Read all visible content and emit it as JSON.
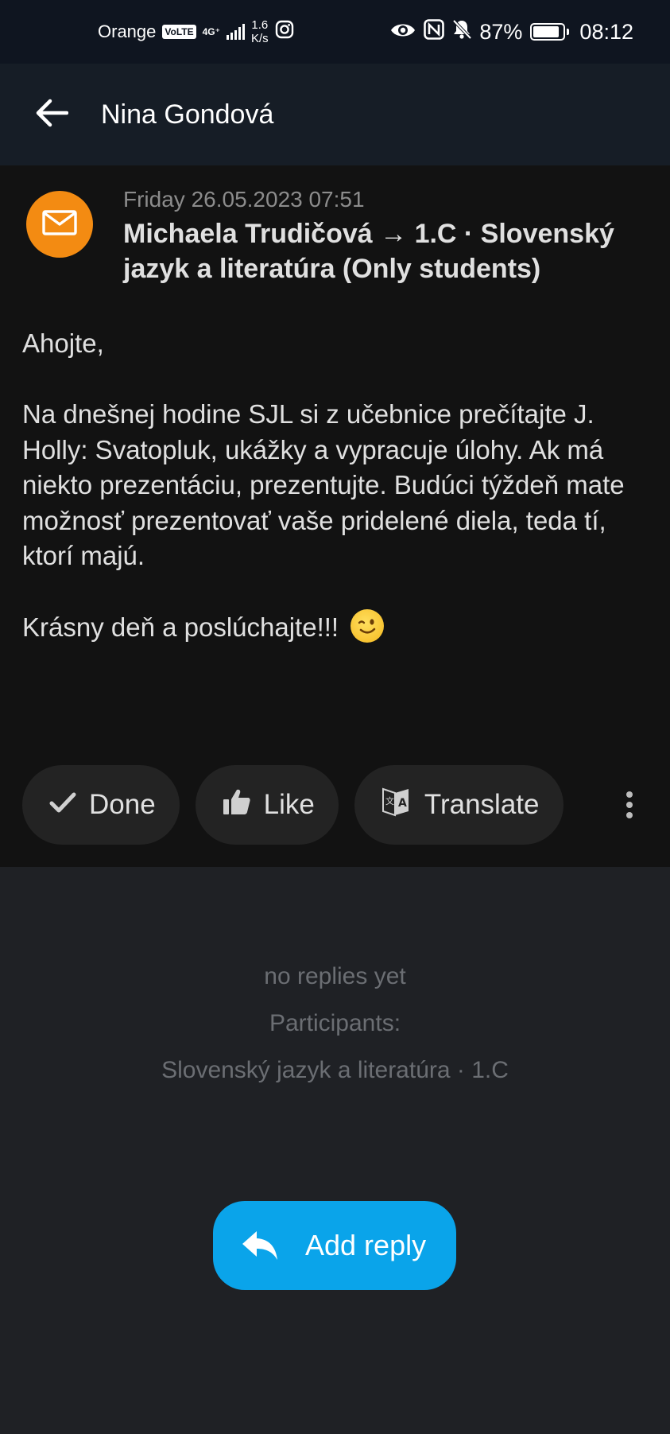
{
  "status_bar": {
    "carrier": "Orange",
    "volte": "VoLTE",
    "network": "4G⁺",
    "speed_value": "1.6",
    "speed_unit": "K/s",
    "battery_percent": "87%",
    "battery_level": 0.87,
    "time": "08:12"
  },
  "app_bar": {
    "title": "Nina Gondová",
    "back_icon": "arrow-left-icon"
  },
  "message": {
    "avatar_icon": "envelope-icon",
    "avatar_color": "#f38b12",
    "date": "Friday 26.05.2023 07:51",
    "sender_line": "Michaela Trudičová → 1.C · Slovenský jazyk a literatúra (Only students)",
    "body": "Ahojte,\n\nNa dnešnej hodine SJL si z učebnice prečítajte J. Holly: Svatopluk, ukážky a vypracuje úlohy. Ak má niekto prezentáciu, prezentujte. Budúci týždeň mate možnosť prezentovať vaše pridelené diela, teda tí, ktorí majú.\n\nKrásny deň a poslúchajte!!!",
    "emoji_icon": "winking-face-icon"
  },
  "actions": {
    "done_label": "Done",
    "like_label": "Like",
    "translate_label": "Translate",
    "more_icon": "more-vertical-icon"
  },
  "replies": {
    "empty_text": "no replies yet",
    "participants_label": "Participants:",
    "participants_value": "Slovenský jazyk a literatúra · 1.C"
  },
  "reply_button": {
    "label": "Add reply",
    "icon": "reply-icon",
    "color": "#0aa4ea"
  }
}
